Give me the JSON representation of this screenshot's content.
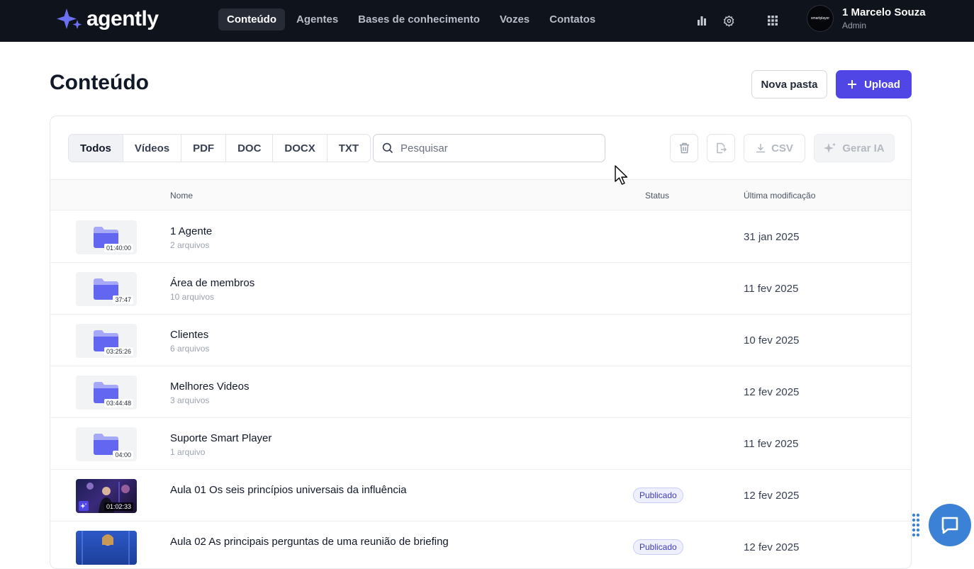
{
  "brand": {
    "name": "agently"
  },
  "nav": {
    "items": [
      {
        "label": "Conteúdo",
        "active": true
      },
      {
        "label": "Agentes"
      },
      {
        "label": "Bases de conhecimento"
      },
      {
        "label": "Vozes"
      },
      {
        "label": "Contatos"
      }
    ]
  },
  "topbar_icons": [
    "bar-chart-icon",
    "gear-icon",
    "apps-grid-icon"
  ],
  "user": {
    "name": "1 Marcelo Souza",
    "role": "Admin",
    "avatar_text": "smartplayer"
  },
  "header": {
    "title": "Conteúdo",
    "new_folder_label": "Nova pasta",
    "upload_label": "Upload"
  },
  "filters": [
    "Todos",
    "Vídeos",
    "PDF",
    "DOC",
    "DOCX",
    "TXT"
  ],
  "active_filter": "Todos",
  "search": {
    "placeholder": "Pesquisar"
  },
  "toolbar": {
    "csv_label": "CSV",
    "generate_label": "Gerar IA"
  },
  "table": {
    "columns": {
      "name": "Nome",
      "status": "Status",
      "modified": "Última modificação"
    },
    "rows": [
      {
        "type": "folder",
        "name": "1 Agente",
        "sub": "2 arquivos",
        "duration": "01:40:00",
        "date": "31 jan 2025"
      },
      {
        "type": "folder",
        "name": "Área de membros",
        "sub": "10 arquivos",
        "duration": "37:47",
        "date": "11 fev 2025"
      },
      {
        "type": "folder",
        "name": "Clientes",
        "sub": "6 arquivos",
        "duration": "03:25:26",
        "date": "10 fev 2025"
      },
      {
        "type": "folder",
        "name": "Melhores Videos",
        "sub": "3 arquivos",
        "duration": "03:44:48",
        "date": "12 fev 2025"
      },
      {
        "type": "folder",
        "name": "Suporte Smart Player",
        "sub": "1 arquivo",
        "duration": "04:00",
        "date": "11 fev 2025"
      },
      {
        "type": "video",
        "name": "Aula 01 Os seis princípios universais da influência",
        "duration": "01:02:33",
        "status": "Publicado",
        "date": "12 fev 2025"
      },
      {
        "type": "video",
        "name": "Aula 02 As principais perguntas de uma reunião de briefing",
        "status": "Publicado",
        "date": "12 fev 2025"
      }
    ]
  },
  "colors": {
    "topbar": "#0f131c",
    "primary": "#4f46e5",
    "folder": "#6366f1",
    "chat": "#3b82d6"
  }
}
